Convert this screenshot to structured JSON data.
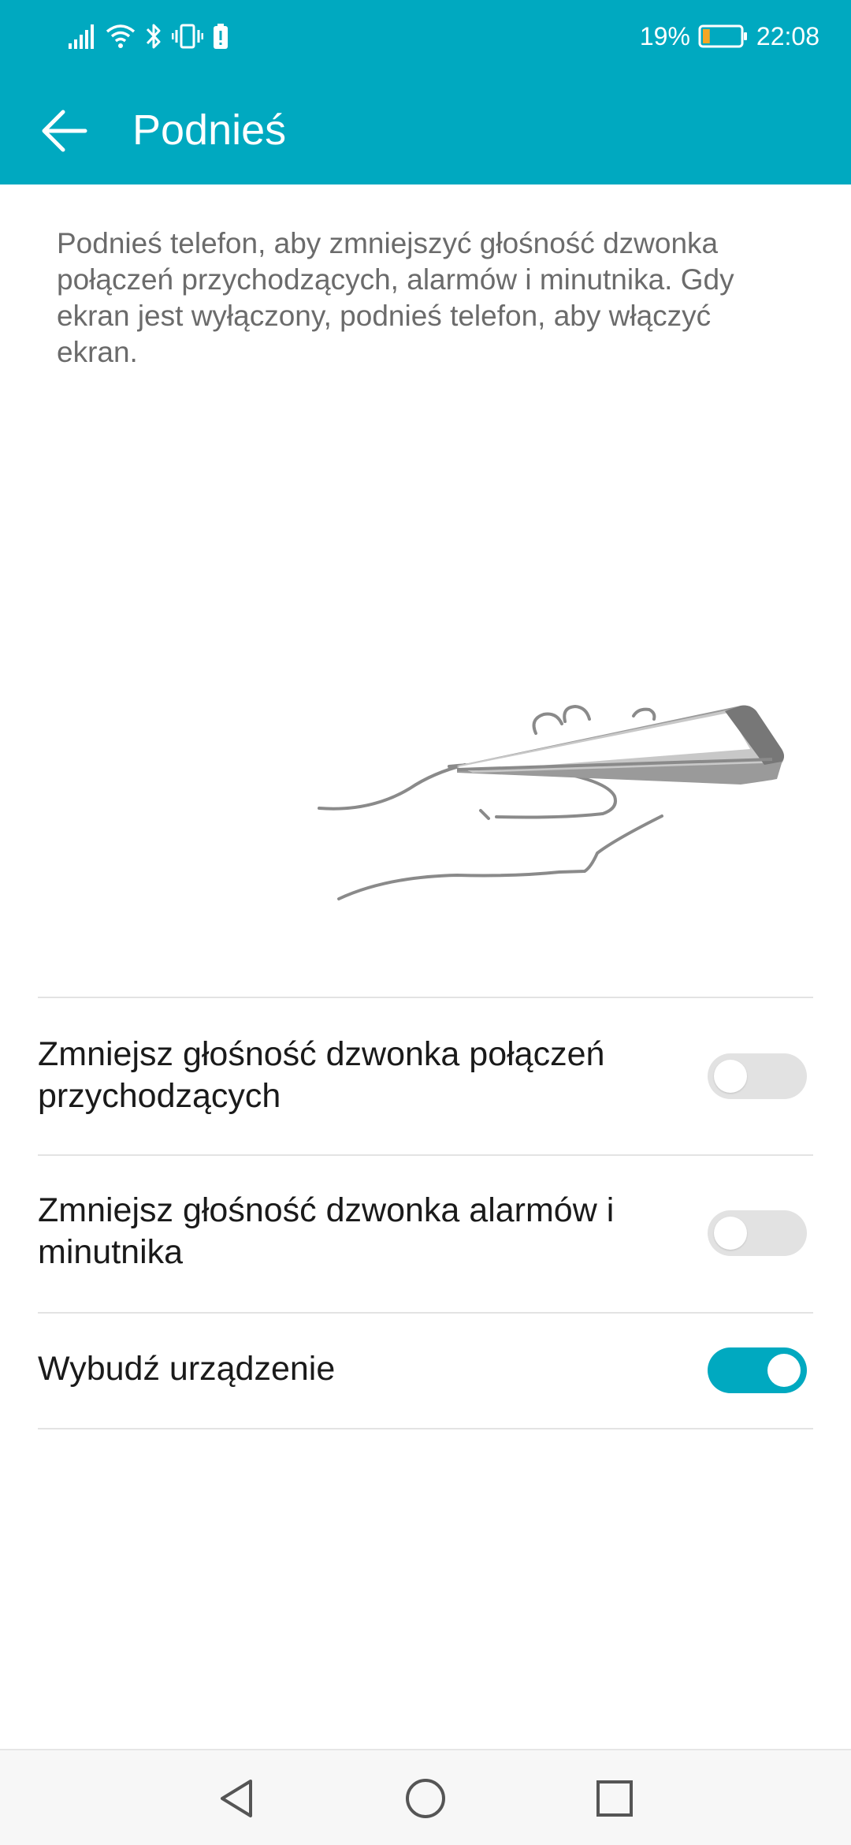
{
  "status_bar": {
    "battery_percent": "19%",
    "time": "22:08",
    "battery_level": 0.19,
    "battery_color": "#f5a623",
    "icons": [
      "signal-icon",
      "wifi-icon",
      "bluetooth-icon",
      "vibrate-icon",
      "battery-alert-icon"
    ]
  },
  "app_bar": {
    "title": "Podnieś",
    "back_icon": "arrow-left-icon",
    "background": "#00a9c0"
  },
  "description": "Podnieś telefon, aby zmniejszyć głośność dzwonka połączeń przychodzących, alarmów i minutnika. Gdy ekran jest wyłączony, podnieś telefon, aby włączyć ekran.",
  "illustration": {
    "icon": "hand-lifting-phone-icon"
  },
  "settings": [
    {
      "label": "Zmniejsz głośność dzwonka połączeń przychodzących",
      "enabled": false
    },
    {
      "label": "Zmniejsz głośność dzwonka alarmów i minutnika",
      "enabled": false
    },
    {
      "label": "Wybudź urządzenie",
      "enabled": true
    }
  ],
  "nav_bar": {
    "icons": [
      "back-triangle-icon",
      "home-circle-icon",
      "recents-square-icon"
    ]
  },
  "colors": {
    "accent": "#00a9c0",
    "toggle_off": "#e2e2e2"
  }
}
